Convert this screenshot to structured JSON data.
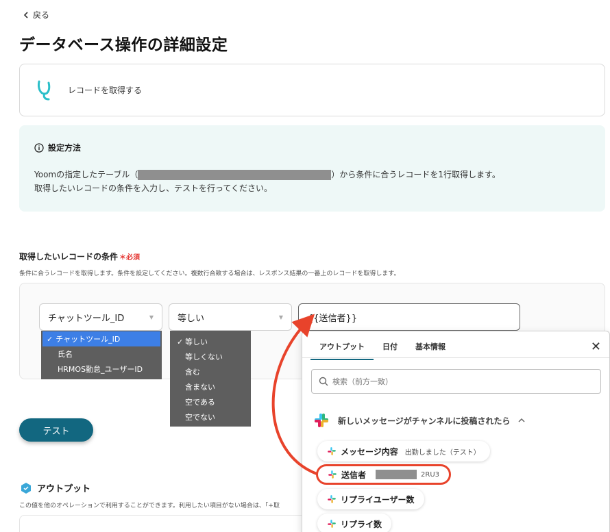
{
  "nav": {
    "back_label": "戻る"
  },
  "page": {
    "title": "データベース操作の詳細設定"
  },
  "operation": {
    "label": "レコードを取得する"
  },
  "info": {
    "heading": "設定方法",
    "line1_prefix": "Yoomの指定したテーブル（",
    "line1_suffix": "）から条件に合うレコードを1行取得します。",
    "line2": "取得したいレコードの条件を入力し、テストを行ってください。"
  },
  "condition": {
    "title": "取得したいレコードの条件",
    "required": "必須",
    "subtitle": "条件に合うレコードを取得します。条件を設定してください。複数行合致する場合は、レスポンス結果の一番上のレコードを取得します。",
    "field_select": "チャットツール_ID",
    "operator_select": "等しい",
    "value": "{{送信者}}",
    "field_options": [
      "チャットツール_ID",
      "氏名",
      "HRMOS勤怠_ユーザーID"
    ],
    "operator_options": [
      "等しい",
      "等しくない",
      "含む",
      "含まない",
      "空である",
      "空でない"
    ]
  },
  "test_button": "テスト",
  "output": {
    "title": "アウトプット",
    "subtitle": "この値を他のオペレーションで利用することができます。利用したい項目がない場合は、「+取"
  },
  "panel": {
    "tabs": [
      "アウトプット",
      "日付",
      "基本情報"
    ],
    "search_placeholder": "検索（前方一致）",
    "trigger_label": "新しいメッセージがチャンネルに投稿されたら",
    "items": [
      {
        "label": "メッセージ内容",
        "sub": "出勤しました（テスト）"
      },
      {
        "label": "送信者",
        "sub": "2RU3"
      },
      {
        "label": "リプライユーザー数",
        "sub": ""
      },
      {
        "label": "リプライ数",
        "sub": ""
      }
    ]
  },
  "colors": {
    "accent": "#126780",
    "highlight": "#e8432b",
    "info_bg": "#eef8f7",
    "selected": "#3d7fe6"
  }
}
